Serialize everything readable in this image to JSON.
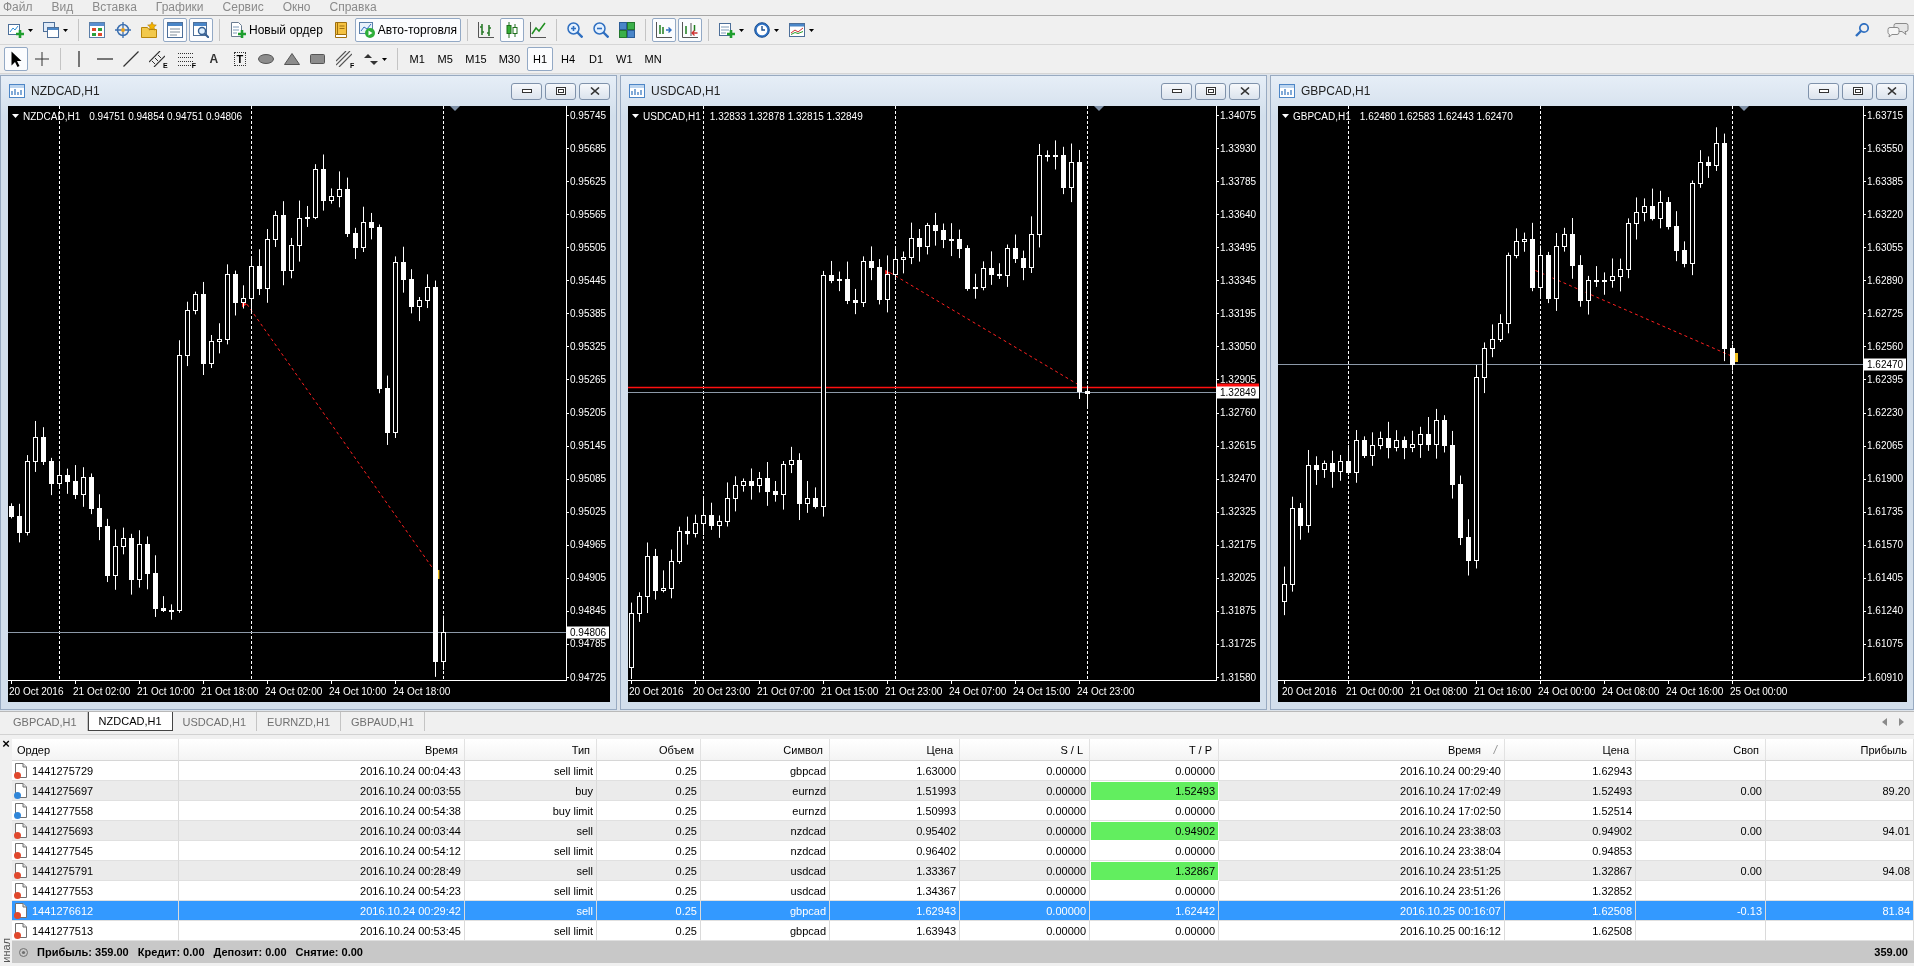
{
  "menu": [
    "Файл",
    "Вид",
    "Вставка",
    "Графики",
    "Сервис",
    "Окно",
    "Справка"
  ],
  "toolbar_main": [
    {
      "kind": "icon",
      "pressed": false,
      "dropdown": true
    },
    {
      "kind": "icon",
      "pressed": false,
      "dropdown": true
    },
    {
      "kind": "separator"
    },
    {
      "kind": "icon",
      "pressed": false
    },
    {
      "kind": "icon",
      "pressed": false
    },
    {
      "kind": "icon",
      "pressed": false
    },
    {
      "kind": "icon",
      "pressed": true
    },
    {
      "kind": "icon",
      "pressed": true
    },
    {
      "kind": "separator"
    },
    {
      "kind": "labeled",
      "label": "Новый ордер",
      "pressed": false
    },
    {
      "kind": "icon",
      "pressed": false
    },
    {
      "kind": "labeled",
      "label": "Авто-торговля",
      "pressed": true
    },
    {
      "kind": "separator"
    },
    {
      "kind": "icon",
      "pressed": false
    },
    {
      "kind": "icon",
      "pressed": true
    },
    {
      "kind": "icon",
      "pressed": false
    },
    {
      "kind": "separator"
    },
    {
      "kind": "icon",
      "pressed": false
    },
    {
      "kind": "icon",
      "pressed": false
    },
    {
      "kind": "icon",
      "pressed": false
    },
    {
      "kind": "separator"
    },
    {
      "kind": "icon",
      "pressed": true
    },
    {
      "kind": "icon",
      "pressed": true
    },
    {
      "kind": "separator"
    },
    {
      "kind": "icon",
      "pressed": false,
      "dropdown": true
    },
    {
      "kind": "icon",
      "pressed": false,
      "dropdown": true
    },
    {
      "kind": "icon",
      "pressed": false,
      "dropdown": true
    }
  ],
  "toolbar_drawing": [
    {
      "kind": "icon",
      "pressed": true
    },
    {
      "kind": "icon",
      "pressed": false
    },
    {
      "kind": "separator"
    },
    {
      "kind": "icon",
      "pressed": false
    },
    {
      "kind": "icon",
      "pressed": false
    },
    {
      "kind": "icon",
      "pressed": false
    },
    {
      "kind": "icon",
      "pressed": false,
      "sub": "E"
    },
    {
      "kind": "icon",
      "pressed": false,
      "sub": "F"
    },
    {
      "kind": "glyph",
      "label": "A",
      "pressed": false
    },
    {
      "kind": "framed",
      "label": "T",
      "pressed": false
    },
    {
      "kind": "icon",
      "pressed": false
    },
    {
      "kind": "icon",
      "pressed": false
    },
    {
      "kind": "icon",
      "pressed": false
    },
    {
      "kind": "icon",
      "pressed": false,
      "sub": "F"
    },
    {
      "kind": "icon",
      "pressed": false,
      "dropdown": true
    },
    {
      "kind": "separator"
    },
    {
      "kind": "period",
      "label": "M1",
      "selected": false
    },
    {
      "kind": "period",
      "label": "M5",
      "selected": false
    },
    {
      "kind": "period",
      "label": "M15",
      "selected": false
    },
    {
      "kind": "period",
      "label": "M30",
      "selected": false
    },
    {
      "kind": "period",
      "label": "H1",
      "selected": true
    },
    {
      "kind": "period",
      "label": "H4",
      "selected": false
    },
    {
      "kind": "period",
      "label": "D1",
      "selected": false
    },
    {
      "kind": "period",
      "label": "W1",
      "selected": false
    },
    {
      "kind": "period",
      "label": "MN",
      "selected": false
    }
  ],
  "charts": [
    {
      "title": "NZDCAD,H1",
      "symbol": "NZDCAD,H1",
      "ohlc": "0.94751 0.94854 0.94751 0.94806",
      "price_axis": [
        {
          "label": "0.95745",
          "kind": "tick"
        },
        {
          "label": "0.95685",
          "kind": "tick"
        },
        {
          "label": "0.95625",
          "kind": "tick"
        },
        {
          "label": "0.95565",
          "kind": "tick"
        },
        {
          "label": "0.95505",
          "kind": "tick"
        },
        {
          "label": "0.95445",
          "kind": "tick"
        },
        {
          "label": "0.95385",
          "kind": "tick"
        },
        {
          "label": "0.95325",
          "kind": "tick"
        },
        {
          "label": "0.95265",
          "kind": "tick"
        },
        {
          "label": "0.95205",
          "kind": "tick"
        },
        {
          "label": "0.95145",
          "kind": "tick"
        },
        {
          "label": "0.95085",
          "kind": "tick"
        },
        {
          "label": "0.95025",
          "kind": "tick"
        },
        {
          "label": "0.94965",
          "kind": "tick"
        },
        {
          "label": "0.94905",
          "kind": "tick"
        },
        {
          "label": "0.94845",
          "kind": "tick"
        },
        {
          "label": "0.94806",
          "kind": "current"
        },
        {
          "label": "0.94785",
          "kind": "tick"
        },
        {
          "label": "0.94725",
          "kind": "tick"
        }
      ],
      "time_axis": [
        "20 Oct 2016",
        "21 Oct 02:00",
        "21 Oct 10:00",
        "21 Oct 18:00",
        "24 Oct 02:00",
        "24 Oct 10:00",
        "24 Oct 18:00"
      ]
    },
    {
      "title": "USDCAD,H1",
      "symbol": "USDCAD,H1",
      "ohlc": "1.32833 1.32878 1.32815 1.32849",
      "price_axis": [
        {
          "label": "1.34075",
          "kind": "tick"
        },
        {
          "label": "1.33930",
          "kind": "tick"
        },
        {
          "label": "1.33785",
          "kind": "tick"
        },
        {
          "label": "1.33640",
          "kind": "tick"
        },
        {
          "label": "1.33495",
          "kind": "tick"
        },
        {
          "label": "1.33345",
          "kind": "tick"
        },
        {
          "label": "1.33195",
          "kind": "tick"
        },
        {
          "label": "1.33050",
          "kind": "tick"
        },
        {
          "label": "1.32905",
          "kind": "tick"
        },
        {
          "label": "1.32849",
          "kind": "current"
        },
        {
          "label": "1.32760",
          "kind": "tick"
        },
        {
          "label": "1.32615",
          "kind": "tick"
        },
        {
          "label": "1.32470",
          "kind": "tick"
        },
        {
          "label": "1.32325",
          "kind": "tick"
        },
        {
          "label": "1.32175",
          "kind": "tick"
        },
        {
          "label": "1.32025",
          "kind": "tick"
        },
        {
          "label": "1.31875",
          "kind": "tick"
        },
        {
          "label": "1.31725",
          "kind": "tick"
        },
        {
          "label": "1.31580",
          "kind": "tick"
        }
      ],
      "time_axis": [
        "20 Oct 2016",
        "20 Oct 23:00",
        "21 Oct 07:00",
        "21 Oct 15:00",
        "21 Oct 23:00",
        "24 Oct 07:00",
        "24 Oct 15:00",
        "24 Oct 23:00"
      ]
    },
    {
      "title": "GBPCAD,H1",
      "symbol": "GBPCAD,H1",
      "ohlc": "1.62480 1.62583 1.62443 1.62470",
      "price_axis": [
        {
          "label": "1.63715",
          "kind": "tick"
        },
        {
          "label": "1.63550",
          "kind": "tick"
        },
        {
          "label": "1.63385",
          "kind": "tick"
        },
        {
          "label": "1.63220",
          "kind": "tick"
        },
        {
          "label": "1.63055",
          "kind": "tick"
        },
        {
          "label": "1.62890",
          "kind": "tick"
        },
        {
          "label": "1.62725",
          "kind": "tick"
        },
        {
          "label": "1.62560",
          "kind": "tick"
        },
        {
          "label": "1.62470",
          "kind": "current"
        },
        {
          "label": "1.62395",
          "kind": "tick"
        },
        {
          "label": "1.62230",
          "kind": "tick"
        },
        {
          "label": "1.62065",
          "kind": "tick"
        },
        {
          "label": "1.61900",
          "kind": "tick"
        },
        {
          "label": "1.61735",
          "kind": "tick"
        },
        {
          "label": "1.61570",
          "kind": "tick"
        },
        {
          "label": "1.61405",
          "kind": "tick"
        },
        {
          "label": "1.61240",
          "kind": "tick"
        },
        {
          "label": "1.61075",
          "kind": "tick"
        },
        {
          "label": "1.60910",
          "kind": "tick"
        }
      ],
      "time_axis": [
        "20 Oct 2016",
        "21 Oct 00:00",
        "21 Oct 08:00",
        "21 Oct 16:00",
        "24 Oct 00:00",
        "24 Oct 08:00",
        "24 Oct 16:00",
        "25 Oct 00:00"
      ]
    }
  ],
  "chart_tabs": [
    {
      "label": "GBPCAD,H1",
      "selected": false
    },
    {
      "label": "NZDCAD,H1",
      "selected": true
    },
    {
      "label": "USDCAD,H1",
      "selected": false
    },
    {
      "label": "EURNZD,H1",
      "selected": false
    },
    {
      "label": "GBPAUD,H1",
      "selected": false
    }
  ],
  "terminal": {
    "close": "×",
    "caption": "инал",
    "columns": [
      {
        "label": "Ордер",
        "sorted": false
      },
      {
        "label": "Время",
        "sorted": false
      },
      {
        "label": "Тип",
        "sorted": false
      },
      {
        "label": "Объем",
        "sorted": false
      },
      {
        "label": "Символ",
        "sorted": false
      },
      {
        "label": "Цена",
        "sorted": false
      },
      {
        "label": "S / L",
        "sorted": false
      },
      {
        "label": "T / P",
        "sorted": false
      },
      {
        "label": "Время",
        "sorted": true
      },
      {
        "label": "Цена",
        "sorted": false
      },
      {
        "label": "Своп",
        "sorted": false
      },
      {
        "label": "Прибыль",
        "sorted": false
      }
    ],
    "rows": [
      {
        "order": "1441275729",
        "open_time": "2016.10.24 00:04:43",
        "type": "sell limit",
        "volume": "0.25",
        "symbol": "gbpcad",
        "open_price": "1.63000",
        "sl": "0.00000",
        "tp": "0.00000",
        "close_time": "2016.10.24 00:29:40",
        "close_price": "1.62943",
        "color": "#e0482c",
        "tp_highlight": false,
        "selected": false
      },
      {
        "order": "1441275697",
        "open_time": "2016.10.24 00:03:55",
        "type": "buy",
        "volume": "0.25",
        "symbol": "eurnzd",
        "open_price": "1.51993",
        "sl": "0.00000",
        "tp": "1.52493",
        "close_time": "2016.10.24 17:02:49",
        "close_price": "1.52493",
        "swap": "0.00",
        "profit": "89.20",
        "color": "#2f86d8",
        "tp_highlight": true,
        "selected": false
      },
      {
        "order": "1441277558",
        "open_time": "2016.10.24 00:54:38",
        "type": "buy limit",
        "volume": "0.25",
        "symbol": "eurnzd",
        "open_price": "1.50993",
        "sl": "0.00000",
        "tp": "0.00000",
        "close_time": "2016.10.24 17:02:50",
        "close_price": "1.52514",
        "color": "#2f86d8",
        "tp_highlight": false,
        "selected": false
      },
      {
        "order": "1441275693",
        "open_time": "2016.10.24 00:03:44",
        "type": "sell",
        "volume": "0.25",
        "symbol": "nzdcad",
        "open_price": "0.95402",
        "sl": "0.00000",
        "tp": "0.94902",
        "close_time": "2016.10.24 23:38:03",
        "close_price": "0.94902",
        "swap": "0.00",
        "profit": "94.01",
        "color": "#e0482c",
        "tp_highlight": true,
        "selected": false
      },
      {
        "order": "1441277545",
        "open_time": "2016.10.24 00:54:12",
        "type": "sell limit",
        "volume": "0.25",
        "symbol": "nzdcad",
        "open_price": "0.96402",
        "sl": "0.00000",
        "tp": "0.00000",
        "close_time": "2016.10.24 23:38:04",
        "close_price": "0.94853",
        "color": "#e0482c",
        "tp_highlight": false,
        "selected": false
      },
      {
        "order": "1441275791",
        "open_time": "2016.10.24 00:28:49",
        "type": "sell",
        "volume": "0.25",
        "symbol": "usdcad",
        "open_price": "1.33367",
        "sl": "0.00000",
        "tp": "1.32867",
        "close_time": "2016.10.24 23:51:25",
        "close_price": "1.32867",
        "swap": "0.00",
        "profit": "94.08",
        "color": "#e0482c",
        "tp_highlight": true,
        "selected": false
      },
      {
        "order": "1441277553",
        "open_time": "2016.10.24 00:54:23",
        "type": "sell limit",
        "volume": "0.25",
        "symbol": "usdcad",
        "open_price": "1.34367",
        "sl": "0.00000",
        "tp": "0.00000",
        "close_time": "2016.10.24 23:51:26",
        "close_price": "1.32852",
        "color": "#e0482c",
        "tp_highlight": false,
        "selected": false
      },
      {
        "order": "1441276612",
        "open_time": "2016.10.24 00:29:42",
        "type": "sell",
        "volume": "0.25",
        "symbol": "gbpcad",
        "open_price": "1.62943",
        "sl": "0.00000",
        "tp": "1.62442",
        "close_time": "2016.10.25 00:16:07",
        "close_price": "1.62508",
        "swap": "-0.13",
        "profit": "81.84",
        "color": "#e0482c",
        "tp_highlight": false,
        "selected": true
      },
      {
        "order": "1441277513",
        "open_time": "2016.10.24 00:53:45",
        "type": "sell limit",
        "volume": "0.25",
        "symbol": "gbpcad",
        "open_price": "1.63943",
        "sl": "0.00000",
        "tp": "0.00000",
        "close_time": "2016.10.25 00:16:12",
        "close_price": "1.62508",
        "color": "#e0482c",
        "tp_highlight": false,
        "selected": false
      }
    ],
    "summary": [
      "Прибыль: 359.00",
      "Кредит: 0.00",
      "Депозит: 0.00",
      "Снятие: 0.00"
    ],
    "total": "359.00"
  }
}
